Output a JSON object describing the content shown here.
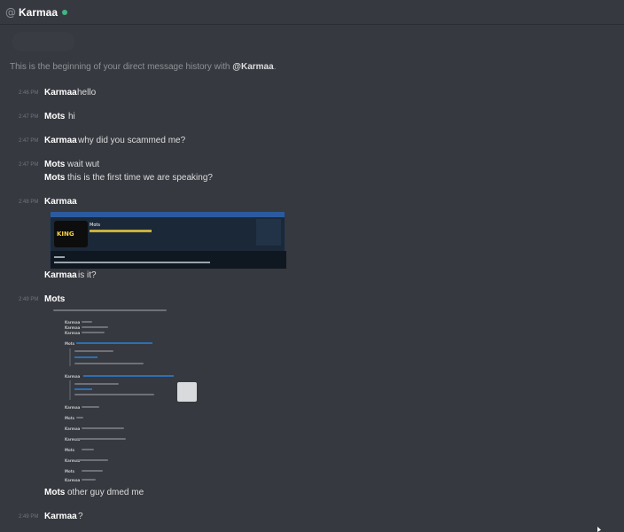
{
  "header": {
    "at": "@",
    "title": "Karmaa"
  },
  "intro": {
    "prefix": "This is the beginning of your direct message history with ",
    "mention": "@Karmaa",
    "suffix": "."
  },
  "messages": [
    {
      "ts": "2:46 PM",
      "author": "Karmaa",
      "text": "hello"
    },
    {
      "ts": "2:47 PM",
      "author": "Mots",
      "text": "hi"
    },
    {
      "ts": "2:47 PM",
      "author": "Karmaa",
      "text": "why did you scammed me?"
    },
    {
      "ts": "2:47 PM",
      "author": "Mots",
      "text": "wait wut"
    },
    {
      "ts": "",
      "author": "Mots",
      "text": "this is the first time we are speaking?"
    },
    {
      "ts": "2:48 PM",
      "author": "Karmaa",
      "text": ""
    },
    {
      "ts": "",
      "author": "Karmaa",
      "text": "is it?"
    },
    {
      "ts": "2:49 PM",
      "author": "Mots",
      "text": ""
    },
    {
      "ts": "",
      "author": "Mots",
      "text": "other guy dmed me"
    },
    {
      "ts": "2:49 PM",
      "author": "Karmaa",
      "text": "?"
    }
  ],
  "embed": {
    "logo_text": "KING",
    "profile_name": "Mots"
  },
  "nested": {
    "authors": [
      "Karmaa",
      "Karmaa",
      "Karmaa",
      "Mots",
      "Karmaa",
      "Karmaa",
      "Mots",
      "Karmaa",
      "Karmaa",
      "Mots",
      "Karmaa",
      "Mots",
      "Karmaa",
      "Mots"
    ]
  }
}
